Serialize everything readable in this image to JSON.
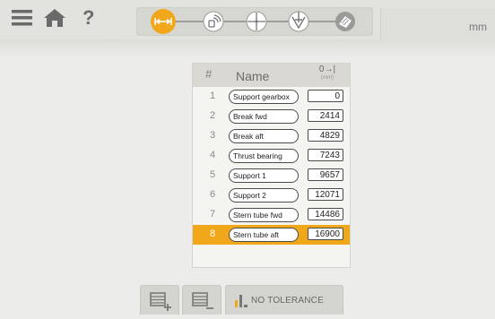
{
  "header": {
    "units": "mm",
    "help": "?"
  },
  "steps": [
    {
      "id": "distance",
      "icon": "distance-arrows-icon",
      "active": true
    },
    {
      "id": "sensor",
      "icon": "wireless-sensor-icon",
      "active": false
    },
    {
      "id": "center",
      "icon": "crosshair-icon",
      "active": false
    },
    {
      "id": "measure",
      "icon": "measure-down-icon",
      "active": false
    },
    {
      "id": "result",
      "icon": "striped-gauge-icon",
      "active": false
    }
  ],
  "table": {
    "columns": {
      "number": "#",
      "name": "Name",
      "distance_icon": "0→|",
      "distance_unit": "(mm)"
    },
    "rows": [
      {
        "num": "1",
        "name": "Support gearbox",
        "value": "0"
      },
      {
        "num": "2",
        "name": "Break fwd",
        "value": "2414"
      },
      {
        "num": "3",
        "name": "Break aft",
        "value": "4829"
      },
      {
        "num": "4",
        "name": "Thrust bearing",
        "value": "7243"
      },
      {
        "num": "5",
        "name": "Support 1",
        "value": "9657"
      },
      {
        "num": "6",
        "name": "Support 2",
        "value": "12071"
      },
      {
        "num": "7",
        "name": "Stern tube fwd",
        "value": "14486"
      },
      {
        "num": "8",
        "name": "Stern tube aft",
        "value": "16900"
      }
    ],
    "selected_row": 8
  },
  "toolbar": {
    "add_label": "",
    "remove_label": "",
    "tolerance_label": "NO TOLERANCE"
  },
  "colors": {
    "accent": "#f0a81a",
    "topbar": "#e2e2de",
    "background": "#ececea"
  }
}
